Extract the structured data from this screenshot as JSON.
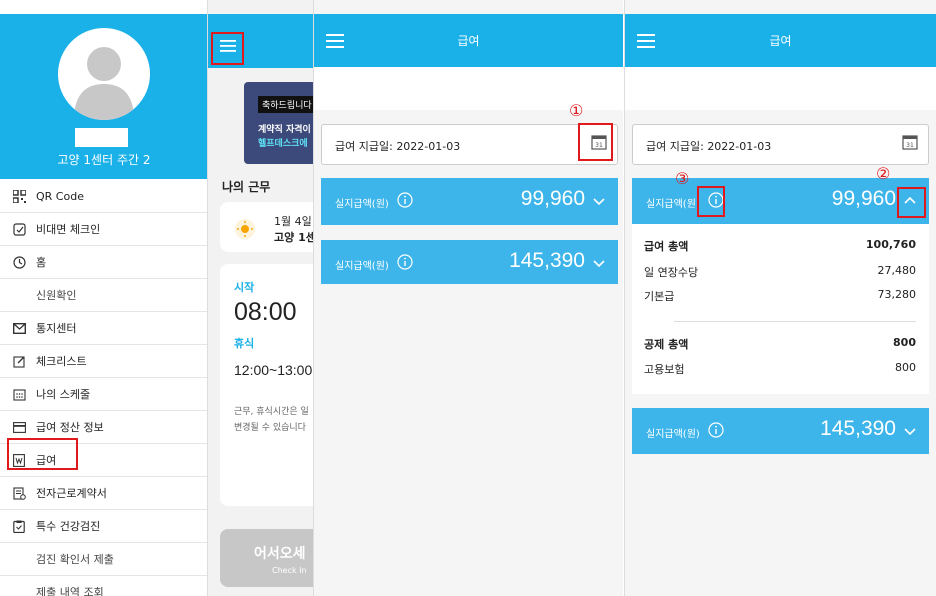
{
  "sidebar": {
    "center_name": "고양 1센터 주간 2",
    "items": [
      {
        "label": "QR Code",
        "icon": "qr-code-icon"
      },
      {
        "label": "비대면 체크인",
        "icon": "checkin-icon"
      },
      {
        "label": "홈",
        "icon": "clock-icon"
      },
      {
        "label": "신원확인",
        "icon": ""
      },
      {
        "label": "통지센터",
        "icon": "mail-icon"
      },
      {
        "label": "체크리스트",
        "icon": "edit-icon"
      },
      {
        "label": "나의 스케줄",
        "icon": "calendar-icon"
      },
      {
        "label": "급여 정산 정보",
        "icon": "card-icon"
      },
      {
        "label": "급여",
        "icon": "won-icon"
      },
      {
        "label": "전자근로계약서",
        "icon": "contract-icon"
      },
      {
        "label": "특수 건강검진",
        "icon": "clipboard-icon"
      },
      {
        "label": "검진 확인서 제출",
        "icon": ""
      },
      {
        "label": "제출 내역 조회",
        "icon": ""
      }
    ]
  },
  "home": {
    "banner_tag": "축하드립니다",
    "banner_line1": "계약직 자격이",
    "banner_line2": "헬프데스크에",
    "my_work_title": "나의 근무",
    "date_text": "1월 4일",
    "location_text": "고양 1센",
    "start_label": "시작",
    "start_time": "08:00",
    "break_label": "휴식",
    "break_time": "12:00~13:00",
    "note_line1": "근무, 휴식시간은 일",
    "note_line2": "변경될 수 있습니다",
    "checkin_button": "어서오세",
    "checkin_sub": "Check In"
  },
  "pay_screen": {
    "title": "급여",
    "date_label": "급여 지급일:",
    "date_value": "2022-01-03",
    "amount_label": "실지급액(원)",
    "amount1": "99,960",
    "amount2": "145,390",
    "gross_label": "급여 총액",
    "gross_value": "100,760",
    "overtime_label": "일 연장수당",
    "overtime_value": "27,480",
    "base_label": "기본급",
    "base_value": "73,280",
    "deduct_label": "공제 총액",
    "deduct_value": "800",
    "insurance_label": "고용보험",
    "insurance_value": "800"
  },
  "annotations": {
    "n1": "①",
    "n2": "②",
    "n3": "③"
  },
  "colors": {
    "header": "#1ab0e8",
    "amount_bar": "#3db5ea",
    "highlight": "#e0191c"
  }
}
